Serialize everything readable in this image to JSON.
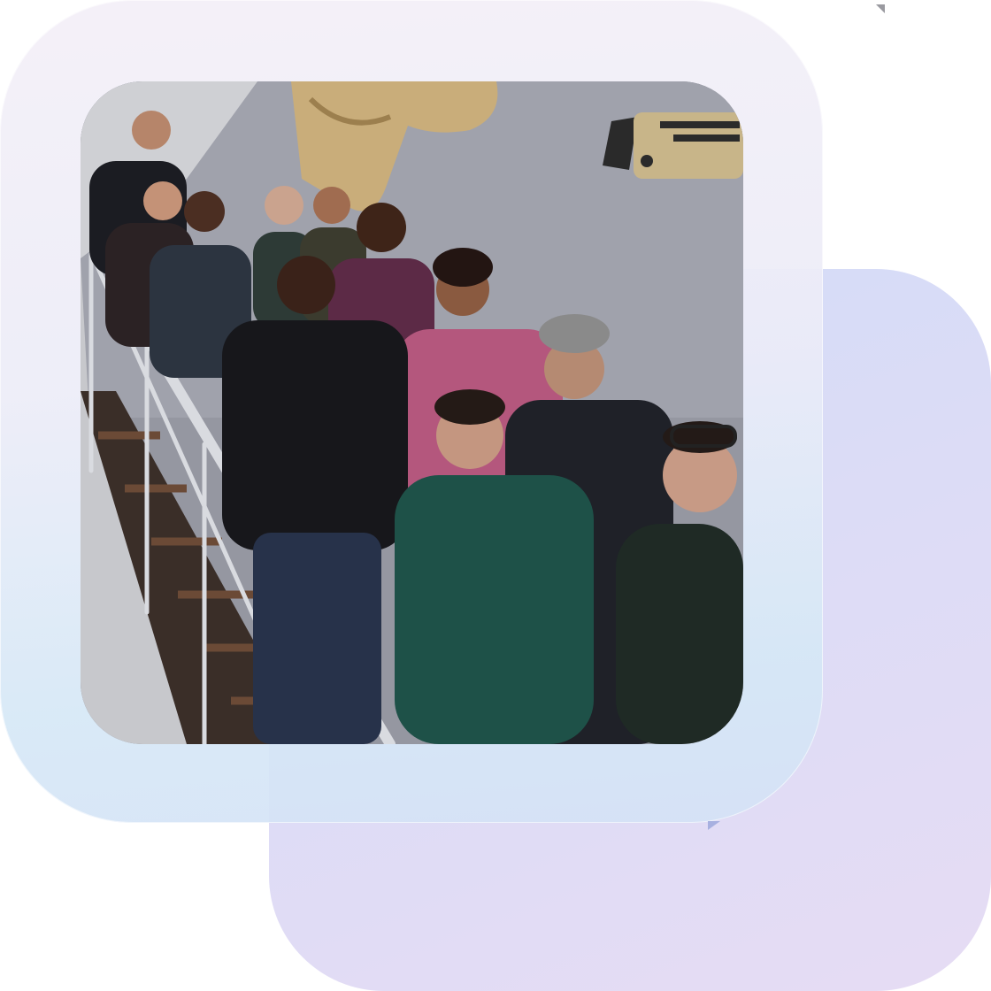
{
  "image": {
    "alt": "",
    "accent_colors": {
      "back_card": "#dcdcf6",
      "front_card": "#eeeef8"
    }
  }
}
